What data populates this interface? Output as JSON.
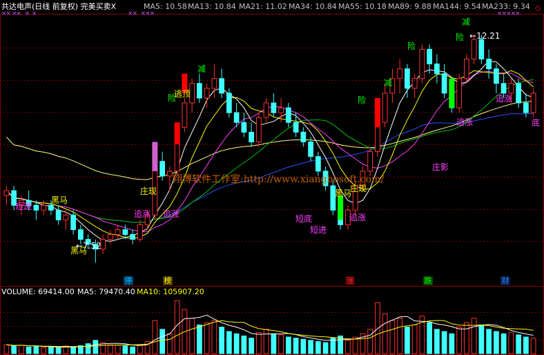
{
  "header": {
    "title": "共达电声(日线 前复权) 完美买卖X",
    "ma_labels": [
      {
        "text": "MA5: 10.58",
        "color": "#ffffff"
      },
      {
        "text": "MA13: 10.84",
        "color": "#2a52ff"
      },
      {
        "text": "MA21: 11.02",
        "color": "#ffffff"
      },
      {
        "text": "MA34: 10.84",
        "color": "#ffff00"
      },
      {
        "text": "MA55: 10.18",
        "color": "#ff60ff"
      },
      {
        "text": "MA89: 9.88",
        "color": "#00e000"
      },
      {
        "text": "MA144: 9.54",
        "color": "#ffffff"
      },
      {
        "text": "MA233: 9.34",
        "color": "#2a52ff"
      }
    ],
    "close_icon": "◇"
  },
  "price_panel": {
    "high_label": "12.21",
    "low_label": "7.52",
    "markers": {
      "duanjin": "短进",
      "heima": "黑马",
      "zhuangxian": "庄现",
      "zhuizhang": "追涨",
      "jian": "减",
      "xian": "险",
      "taoding": "逃顶",
      "zhuangying": "庄影",
      "didi": "底",
      "duandi": "短底"
    },
    "watermark": "翔博软件工作室:http://www.xiangbosoft.com/"
  },
  "event_tags": [
    {
      "text": "停",
      "color": "#00c0ff"
    },
    {
      "text": "榜",
      "color": "#ffff00"
    },
    {
      "text": "涨",
      "color": "#ff3030"
    },
    {
      "text": "跌",
      "color": "#00ff00"
    },
    {
      "text": "财",
      "color": "#4080ff"
    }
  ],
  "volume_header": [
    {
      "text": "VOLUME: 69414.00",
      "color": "#ffffff"
    },
    {
      "text": "MA5: 79470.40",
      "color": "#ffffff"
    },
    {
      "text": "MA10: 105907.20",
      "color": "#ffff00"
    }
  ],
  "chart_data": {
    "type": "candlestick",
    "price_range": [
      7.3,
      12.6
    ],
    "candles": [
      [
        8.9,
        9.1,
        8.7,
        9.0
      ],
      [
        9.0,
        9.1,
        8.6,
        8.7
      ],
      [
        8.7,
        8.9,
        8.5,
        8.8
      ],
      [
        8.8,
        9.0,
        8.6,
        8.7
      ],
      [
        8.7,
        8.8,
        8.4,
        8.6
      ],
      [
        8.6,
        8.8,
        8.5,
        8.7
      ],
      [
        8.7,
        8.8,
        8.5,
        8.6
      ],
      [
        8.6,
        8.7,
        8.3,
        8.4
      ],
      [
        8.4,
        8.6,
        8.2,
        8.5
      ],
      [
        8.5,
        8.6,
        8.1,
        8.2
      ],
      [
        8.2,
        8.3,
        7.9,
        8.0
      ],
      [
        8.0,
        8.1,
        7.8,
        7.9
      ],
      [
        7.9,
        8.0,
        7.52,
        7.8
      ],
      [
        7.8,
        8.1,
        7.7,
        8.0
      ],
      [
        8.0,
        8.2,
        7.9,
        8.1
      ],
      [
        8.1,
        8.3,
        8.0,
        8.2
      ],
      [
        8.2,
        8.3,
        8.0,
        8.1
      ],
      [
        8.1,
        8.2,
        7.9,
        8.0
      ],
      [
        8.0,
        8.4,
        7.95,
        8.3
      ],
      [
        8.3,
        8.6,
        8.2,
        8.5
      ],
      [
        8.5,
        9.7,
        8.4,
        9.6
      ],
      [
        9.6,
        9.8,
        9.2,
        9.3
      ],
      [
        9.3,
        9.5,
        9.0,
        9.4
      ],
      [
        9.4,
        10.4,
        9.3,
        10.3
      ],
      [
        10.3,
        10.9,
        10.2,
        10.8
      ],
      [
        10.8,
        11.3,
        10.6,
        11.2
      ],
      [
        11.2,
        11.4,
        10.8,
        10.9
      ],
      [
        10.9,
        11.2,
        10.7,
        11.1
      ],
      [
        11.1,
        11.6,
        10.9,
        11.3
      ],
      [
        11.3,
        11.5,
        10.9,
        11.0
      ],
      [
        11.0,
        11.1,
        10.5,
        10.6
      ],
      [
        10.6,
        10.8,
        10.3,
        10.4
      ],
      [
        10.4,
        10.6,
        10.1,
        10.2
      ],
      [
        10.2,
        10.4,
        9.9,
        10.0
      ],
      [
        10.0,
        10.6,
        9.9,
        10.5
      ],
      [
        10.5,
        10.9,
        10.4,
        10.8
      ],
      [
        10.8,
        11.0,
        10.5,
        10.6
      ],
      [
        10.6,
        10.9,
        10.4,
        10.7
      ],
      [
        10.7,
        10.8,
        10.3,
        10.4
      ],
      [
        10.4,
        10.6,
        10.1,
        10.2
      ],
      [
        10.2,
        10.3,
        9.9,
        10.0
      ],
      [
        10.0,
        10.1,
        9.6,
        9.7
      ],
      [
        9.7,
        9.8,
        9.3,
        9.4
      ],
      [
        9.4,
        9.5,
        9.0,
        9.1
      ],
      [
        9.1,
        9.2,
        8.5,
        8.6
      ],
      [
        8.6,
        8.9,
        8.2,
        8.3
      ],
      [
        8.3,
        8.7,
        8.2,
        8.6
      ],
      [
        8.6,
        9.2,
        8.5,
        9.1
      ],
      [
        9.1,
        9.5,
        9.0,
        9.4
      ],
      [
        9.4,
        9.9,
        9.3,
        9.8
      ],
      [
        9.8,
        10.5,
        9.7,
        10.4
      ],
      [
        10.4,
        11.2,
        10.3,
        11.0
      ],
      [
        11.0,
        11.5,
        10.8,
        11.3
      ],
      [
        11.3,
        11.7,
        11.0,
        11.5
      ],
      [
        11.5,
        11.6,
        10.9,
        11.1
      ],
      [
        11.1,
        11.4,
        10.9,
        11.3
      ],
      [
        11.3,
        12.0,
        11.2,
        11.9
      ],
      [
        11.9,
        12.0,
        11.4,
        11.6
      ],
      [
        11.6,
        11.8,
        11.2,
        11.4
      ],
      [
        11.4,
        11.6,
        10.9,
        11.0
      ],
      [
        11.0,
        11.2,
        10.6,
        10.7
      ],
      [
        10.7,
        11.4,
        10.6,
        11.3
      ],
      [
        11.3,
        11.8,
        11.2,
        11.7
      ],
      [
        11.7,
        12.21,
        11.6,
        12.1
      ],
      [
        12.1,
        12.2,
        11.6,
        11.7
      ],
      [
        11.7,
        11.9,
        11.3,
        11.5
      ],
      [
        11.5,
        11.6,
        11.0,
        11.2
      ],
      [
        11.2,
        11.4,
        10.9,
        11.0
      ],
      [
        11.0,
        11.3,
        10.8,
        11.2
      ],
      [
        11.2,
        11.3,
        10.7,
        10.8
      ],
      [
        10.8,
        11.0,
        10.5,
        10.6
      ],
      [
        10.6,
        11.1,
        10.5,
        11.0
      ]
    ],
    "volume_range": [
      0,
      250000
    ],
    "volume": [
      40000,
      35000,
      38000,
      30000,
      32000,
      28000,
      30000,
      26000,
      34000,
      30000,
      36000,
      45000,
      60000,
      50000,
      40000,
      38000,
      35000,
      30000,
      42000,
      55000,
      150000,
      110000,
      90000,
      240000,
      200000,
      160000,
      130000,
      140000,
      150000,
      120000,
      100000,
      90000,
      80000,
      70000,
      95000,
      110000,
      90000,
      85000,
      75000,
      70000,
      65000,
      60000,
      55000,
      50000,
      70000,
      80000,
      60000,
      75000,
      90000,
      110000,
      230000,
      180000,
      150000,
      160000,
      120000,
      130000,
      170000,
      140000,
      110000,
      100000,
      90000,
      120000,
      140000,
      160000,
      130000,
      110000,
      100000,
      90000,
      95000,
      85000,
      75000,
      69414
    ]
  }
}
